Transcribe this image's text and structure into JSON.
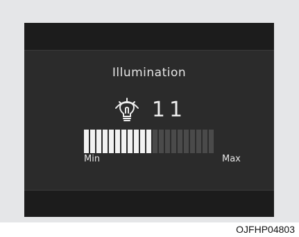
{
  "screen": {
    "title": "Illumination",
    "icon": "illumination-bulb-icon",
    "value": "11",
    "level": {
      "current": 11,
      "max": 21
    },
    "min_label": "Min",
    "max_label": "Max"
  },
  "caption": "OJFHP04803",
  "colors": {
    "display_bg": "#2b2b2b",
    "band_bg": "#1c1c1c",
    "segment_on": "#f2f2f2",
    "segment_off": "#4a4a4a",
    "text": "#e6e6e6",
    "frame": "#e5e6e8"
  }
}
